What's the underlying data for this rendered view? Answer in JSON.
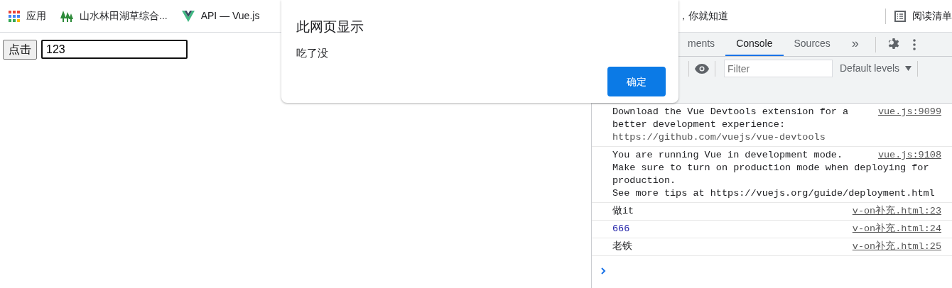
{
  "bookmarks_bar": {
    "items": [
      {
        "kind": "apps",
        "label": "应用"
      },
      {
        "kind": "tree",
        "label": "山水林田湖草综合..."
      },
      {
        "kind": "vue",
        "label": "API — Vue.js"
      },
      {
        "kind": "plain",
        "label": "，你就知道"
      }
    ],
    "reading_list": {
      "label": "阅读清单"
    }
  },
  "page": {
    "button": {
      "label": "点击"
    },
    "input": {
      "value": "123",
      "focused": true
    }
  },
  "devtools": {
    "tabs": [
      {
        "label": "ments",
        "selected": false
      },
      {
        "label": "Console",
        "selected": true
      },
      {
        "label": "Sources",
        "selected": false
      }
    ],
    "more_tabs": "»",
    "filter": {
      "placeholder": "Filter"
    },
    "levels": {
      "label": "Default levels"
    },
    "messages": [
      {
        "kind": "log",
        "text": "Download the Vue Devtools extension for a",
        "lines": [
          "better development experience:"
        ],
        "link_line": {
          "link": "https://github.com/vuejs/vue-devtools"
        },
        "source": "vue.js:9099"
      },
      {
        "kind": "log",
        "text": "You are running Vue in development mode.",
        "lines": [
          "Make sure to turn on production mode when deploying for",
          "production."
        ],
        "link_line": {
          "text": "See more tips at ",
          "link": "https://vuejs.org/guide/deployment.html"
        },
        "source": "vue.js:9108"
      },
      {
        "kind": "log",
        "text": "做it",
        "source": "v-on补充.html:23"
      },
      {
        "kind": "number",
        "text": "666",
        "source": "v-on补充.html:24"
      },
      {
        "kind": "log",
        "text": "老铁",
        "source": "v-on补充.html:25"
      }
    ]
  },
  "dialog": {
    "title": "此网页显示",
    "message": "吃了没",
    "button": "确定"
  }
}
